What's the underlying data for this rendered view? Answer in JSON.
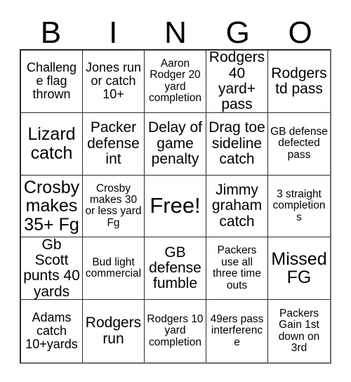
{
  "card": {
    "title": "BINGO",
    "header_letters": [
      "B",
      "I",
      "N",
      "G",
      "O"
    ],
    "free_space_index": 12,
    "colors": {
      "background": "#ffffff",
      "text": "#000000",
      "grid_line": "#2b2b2b",
      "outer_shadow_line": "#6e6e6e"
    },
    "rows": [
      [
        {
          "text": "Challenge flag thrown",
          "size": "m"
        },
        {
          "text": "Jones run or catch 10+",
          "size": "m"
        },
        {
          "text": "Aaron Rodger 20 yard completion",
          "size": "s"
        },
        {
          "text": "Rodgers 40 yard+ pass",
          "size": "l"
        },
        {
          "text": "Rodgers td pass",
          "size": "l"
        }
      ],
      [
        {
          "text": "Lizard catch",
          "size": "xl"
        },
        {
          "text": "Packer defense int",
          "size": "l"
        },
        {
          "text": "Delay of game penalty",
          "size": "l"
        },
        {
          "text": "Drag toe sideline catch",
          "size": "l"
        },
        {
          "text": "GB defense defected pass",
          "size": "s"
        }
      ],
      [
        {
          "text": "Crosby makes 35+ Fg",
          "size": "xl"
        },
        {
          "text": "Crosby makes 30 or less yard Fg",
          "size": "s"
        },
        {
          "text": "Free!",
          "size": "free"
        },
        {
          "text": "Jimmy graham catch",
          "size": "l"
        },
        {
          "text": "3 straight completions",
          "size": "s"
        }
      ],
      [
        {
          "text": "Gb Scott punts 40 yards",
          "size": "l"
        },
        {
          "text": "Bud light commercial",
          "size": "s"
        },
        {
          "text": "GB defense fumble",
          "size": "l"
        },
        {
          "text": "Packers use all three time outs",
          "size": "s"
        },
        {
          "text": "Missed FG",
          "size": "xl"
        }
      ],
      [
        {
          "text": "Adams catch 10+yards",
          "size": "m"
        },
        {
          "text": "Rodgers run",
          "size": "l"
        },
        {
          "text": "Rodgers 10 yard completion",
          "size": "s"
        },
        {
          "text": "49ers pass interference",
          "size": "s"
        },
        {
          "text": "Packers Gain 1st down on 3rd",
          "size": "s"
        }
      ]
    ]
  }
}
